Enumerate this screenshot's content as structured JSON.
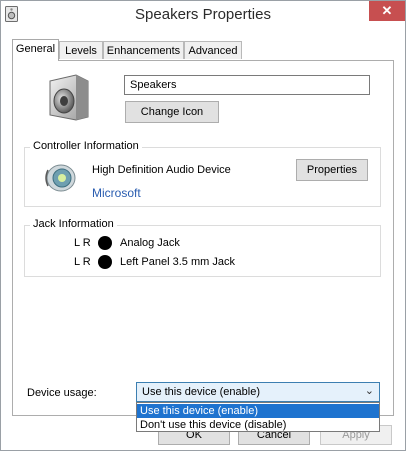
{
  "window": {
    "title": "Speakers Properties",
    "close_label": "✕"
  },
  "tabs": [
    {
      "label": "General",
      "active": true
    },
    {
      "label": "Levels",
      "active": false
    },
    {
      "label": "Enhancements",
      "active": false
    },
    {
      "label": "Advanced",
      "active": false
    }
  ],
  "general": {
    "device_name_value": "Speakers",
    "change_icon_label": "Change Icon"
  },
  "controller": {
    "title": "Controller Information",
    "name": "High Definition Audio Device",
    "vendor": "Microsoft",
    "properties_label": "Properties"
  },
  "jack": {
    "title": "Jack Information",
    "rows": [
      {
        "channels": "L R",
        "label": "Analog Jack"
      },
      {
        "channels": "L R",
        "label": "Left Panel 3.5 mm Jack"
      }
    ]
  },
  "usage": {
    "label": "Device usage:",
    "selected": "Use this device (enable)",
    "chevron": "⌄",
    "options": [
      {
        "label": "Use this device (enable)",
        "highlighted": true
      },
      {
        "label": "Don't use this device (disable)",
        "highlighted": false
      }
    ]
  },
  "buttons": {
    "ok": "OK",
    "cancel": "Cancel",
    "apply": "Apply",
    "apply_enabled": false
  },
  "colors": {
    "close_bg": "#c74f50",
    "selection": "#1e73cf",
    "vendor_link": "#2a5db0"
  },
  "icons": {
    "window": "speaker-window-icon",
    "device": "speaker-icon",
    "controller": "audio-device-icon"
  }
}
